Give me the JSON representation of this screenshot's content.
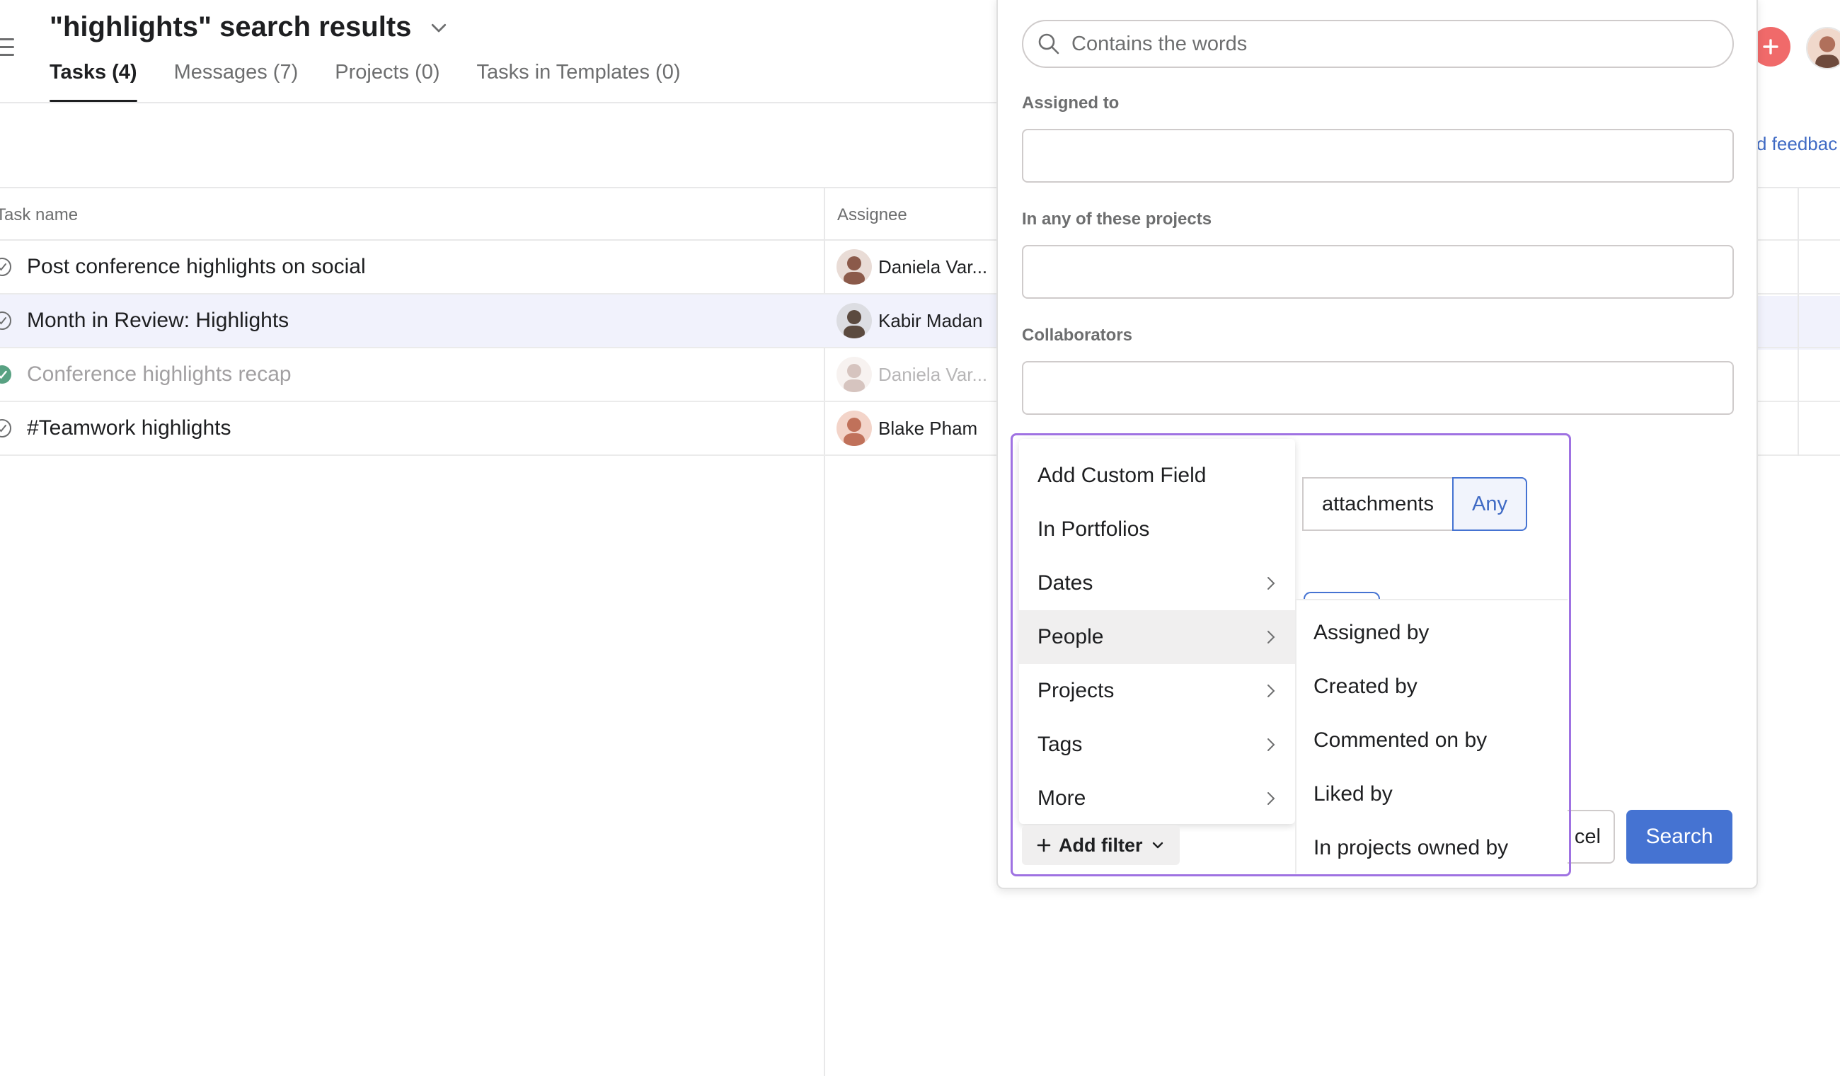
{
  "header": {
    "title": "\"highlights\" search results",
    "tabs": [
      {
        "label": "Tasks (4)",
        "active": true
      },
      {
        "label": "Messages (7)",
        "active": false
      },
      {
        "label": "Projects (0)",
        "active": false
      },
      {
        "label": "Tasks in Templates (0)",
        "active": false
      }
    ],
    "feedback_label": "d feedbac"
  },
  "table": {
    "columns": {
      "name": "Task name",
      "assignee": "Assignee"
    },
    "rows": [
      {
        "task": "Post conference highlights on social",
        "assignee": "Daniela Var...",
        "completed": false,
        "highlighted": false,
        "avatar_color": "#8b5a4a"
      },
      {
        "task": "Month in Review: Highlights",
        "assignee": "Kabir Madan",
        "completed": false,
        "highlighted": true,
        "avatar_color": "#5b4a3f"
      },
      {
        "task": "Conference highlights recap",
        "assignee": "Daniela Var...",
        "completed": true,
        "highlighted": false,
        "avatar_color": "#8b5a4a"
      },
      {
        "task": "#Teamwork highlights",
        "assignee": "Blake Pham",
        "completed": false,
        "highlighted": false,
        "avatar_color": "#c0715a"
      }
    ]
  },
  "search_panel": {
    "search_placeholder": "Contains the words",
    "fields": [
      {
        "label": "Assigned to"
      },
      {
        "label": "In any of these projects"
      },
      {
        "label": "Collaborators"
      }
    ],
    "attachments_toggle": {
      "options": [
        "attachments",
        "Any"
      ],
      "selected": "Any"
    },
    "cancel_label": "cel",
    "search_label": "Search",
    "add_filter_label": "Add filter"
  },
  "filter_menu": {
    "items": [
      {
        "label": "Add Custom Field",
        "submenu": false,
        "active": false
      },
      {
        "label": "In Portfolios",
        "submenu": false,
        "active": false
      },
      {
        "label": "Dates",
        "submenu": true,
        "active": false
      },
      {
        "label": "People",
        "submenu": true,
        "active": true
      },
      {
        "label": "Projects",
        "submenu": true,
        "active": false
      },
      {
        "label": "Tags",
        "submenu": true,
        "active": false
      },
      {
        "label": "More",
        "submenu": true,
        "active": false
      }
    ],
    "people_submenu": [
      "Assigned by",
      "Created by",
      "Commented on by",
      "Liked by",
      "In projects owned by"
    ]
  },
  "colors": {
    "accent": "#4573d2",
    "focus_outline": "#9f72e2",
    "complete_green": "#58a182",
    "add_button": "#f06a6a",
    "row_highlight": "#f1f2fc"
  }
}
